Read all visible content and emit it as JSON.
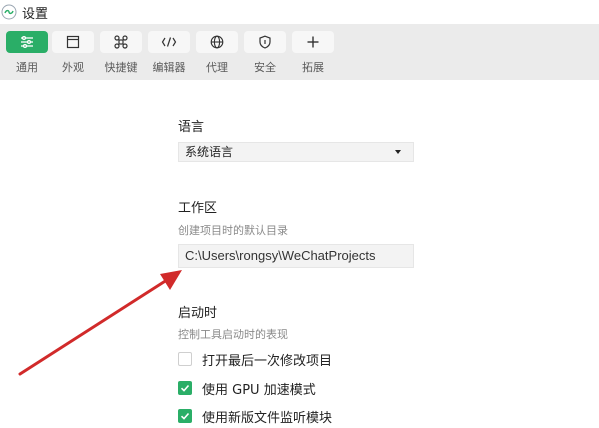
{
  "window": {
    "title": "设置"
  },
  "toolbar": {
    "items": [
      {
        "label": "通用",
        "icon": "list-settings-icon",
        "active": true
      },
      {
        "label": "外观",
        "icon": "window-icon",
        "active": false
      },
      {
        "label": "快捷键",
        "icon": "command-key-icon",
        "active": false
      },
      {
        "label": "编辑器",
        "icon": "code-brackets-icon",
        "active": false
      },
      {
        "label": "代理",
        "icon": "globe-icon",
        "active": false
      },
      {
        "label": "安全",
        "icon": "shield-icon",
        "active": false
      },
      {
        "label": "拓展",
        "icon": "plus-icon",
        "active": false
      }
    ]
  },
  "language": {
    "title": "语言",
    "selected": "系统语言"
  },
  "workspace": {
    "title": "工作区",
    "hint": "创建项目时的默认目录",
    "path": "C:\\Users\\rongsy\\WeChatProjects"
  },
  "startup": {
    "title": "启动时",
    "hint": "控制工具启动时的表现",
    "options": [
      {
        "label": "打开最后一次修改项目",
        "checked": false
      },
      {
        "label": "使用 GPU 加速模式",
        "checked": true
      },
      {
        "label": "使用新版文件监听模块",
        "checked": true
      }
    ]
  },
  "colors": {
    "accent": "#2aae67",
    "toolbar_bg": "#ebebeb",
    "annotation_arrow": "#d12a2a"
  }
}
